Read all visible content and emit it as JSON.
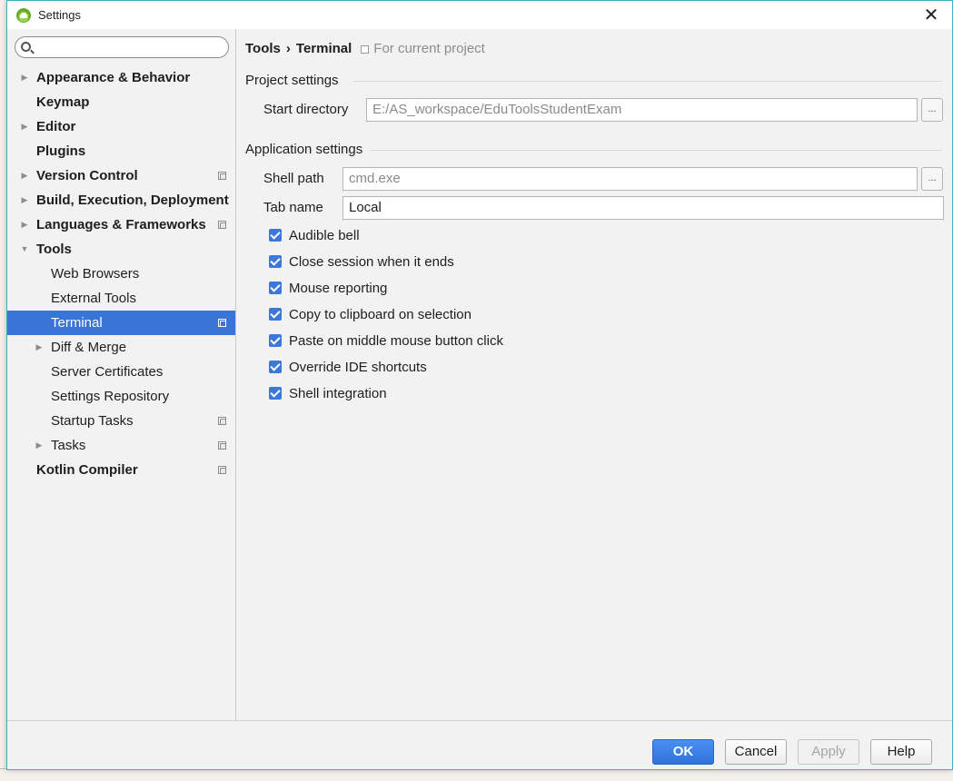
{
  "window": {
    "title": "Settings",
    "close_glyph": "✕"
  },
  "search": {
    "value": "",
    "placeholder": ""
  },
  "sidebar": {
    "items": [
      {
        "label": "Appearance & Behavior",
        "level": 0,
        "expandable": true,
        "expanded": false,
        "project_icon": false
      },
      {
        "label": "Keymap",
        "level": 0,
        "expandable": false,
        "project_icon": false
      },
      {
        "label": "Editor",
        "level": 0,
        "expandable": true,
        "expanded": false,
        "project_icon": false
      },
      {
        "label": "Plugins",
        "level": 0,
        "expandable": false,
        "project_icon": false
      },
      {
        "label": "Version Control",
        "level": 0,
        "expandable": true,
        "expanded": false,
        "project_icon": true
      },
      {
        "label": "Build, Execution, Deployment",
        "level": 0,
        "expandable": true,
        "expanded": false,
        "project_icon": false
      },
      {
        "label": "Languages & Frameworks",
        "level": 0,
        "expandable": true,
        "expanded": false,
        "project_icon": true
      },
      {
        "label": "Tools",
        "level": 0,
        "expandable": true,
        "expanded": true,
        "project_icon": false
      },
      {
        "label": "Web Browsers",
        "level": 1,
        "expandable": false,
        "project_icon": false
      },
      {
        "label": "External Tools",
        "level": 1,
        "expandable": false,
        "project_icon": false
      },
      {
        "label": "Terminal",
        "level": 1,
        "expandable": false,
        "project_icon": true,
        "selected": true
      },
      {
        "label": "Diff & Merge",
        "level": 1,
        "expandable": true,
        "expanded": false,
        "project_icon": false
      },
      {
        "label": "Server Certificates",
        "level": 1,
        "expandable": false,
        "project_icon": false
      },
      {
        "label": "Settings Repository",
        "level": 1,
        "expandable": false,
        "project_icon": false
      },
      {
        "label": "Startup Tasks",
        "level": 1,
        "expandable": false,
        "project_icon": true
      },
      {
        "label": "Tasks",
        "level": 1,
        "expandable": true,
        "expanded": false,
        "project_icon": true
      },
      {
        "label": "Kotlin Compiler",
        "level": 0,
        "expandable": false,
        "project_icon": true
      }
    ]
  },
  "breadcrumb": {
    "parent": "Tools",
    "separator": "›",
    "current": "Terminal",
    "scope_note": "For current project"
  },
  "project_settings": {
    "title": "Project settings",
    "start_directory_label": "Start directory",
    "start_directory_value": "E:/AS_workspace/EduToolsStudentExam",
    "browse_label": "..."
  },
  "application_settings": {
    "title": "Application settings",
    "shell_path_label": "Shell path",
    "shell_path_value": "cmd.exe",
    "tab_name_label": "Tab name",
    "tab_name_value": "Local",
    "browse_label": "...",
    "checkboxes": [
      {
        "label": "Audible bell",
        "checked": true
      },
      {
        "label": "Close session when it ends",
        "checked": true
      },
      {
        "label": "Mouse reporting",
        "checked": true
      },
      {
        "label": "Copy to clipboard on selection",
        "checked": true
      },
      {
        "label": "Paste on middle mouse button click",
        "checked": true
      },
      {
        "label": "Override IDE shortcuts",
        "checked": true
      },
      {
        "label": "Shell integration",
        "checked": true
      }
    ]
  },
  "footer": {
    "ok_label": "OK",
    "cancel_label": "Cancel",
    "apply_label": "Apply",
    "help_label": "Help"
  },
  "colors": {
    "selection": "#3875d7",
    "checkbox": "#3c78d8",
    "primary_button": "#2f74dc",
    "window_border": "#41b0c6"
  }
}
